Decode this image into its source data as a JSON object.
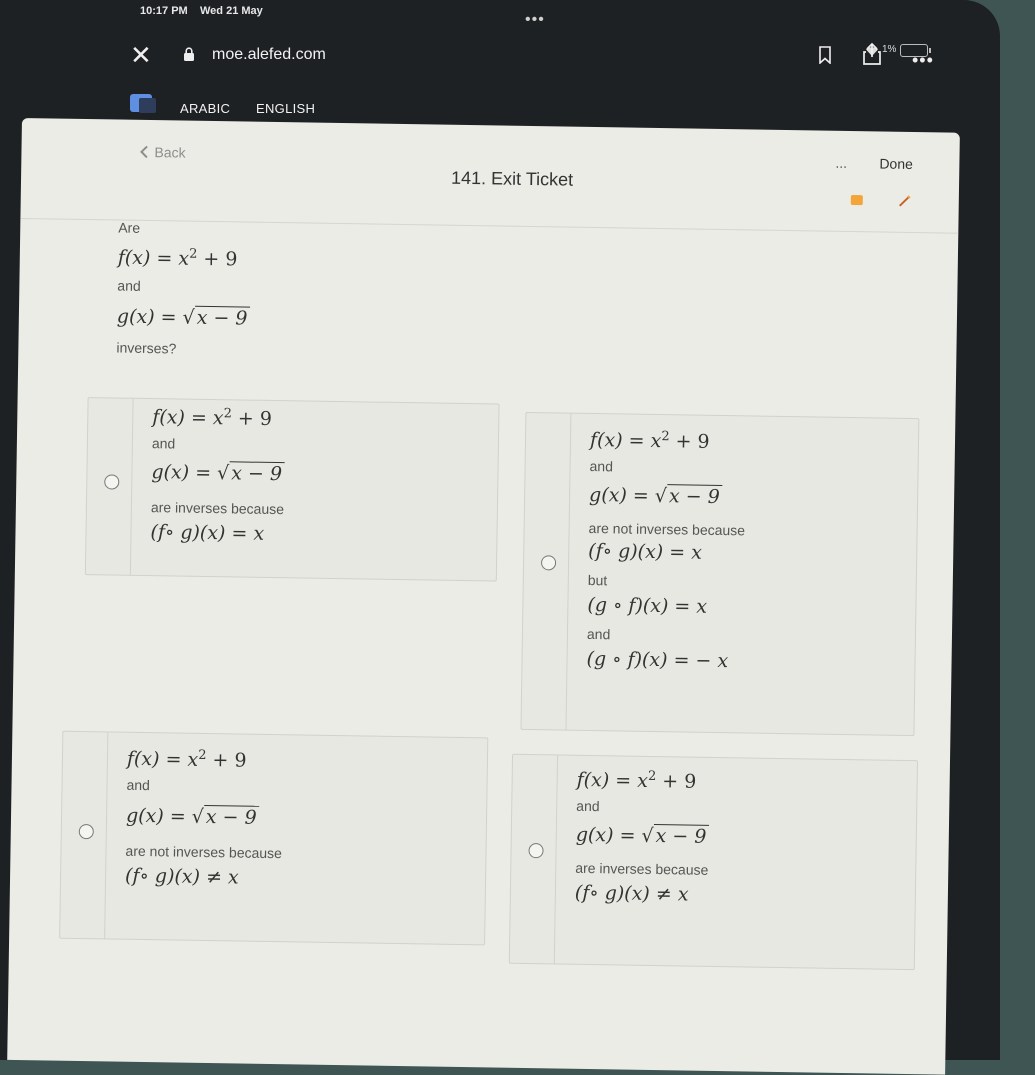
{
  "status_bar": {
    "time": "10:17 PM",
    "date": "Wed 21 May",
    "battery": "1%"
  },
  "browser": {
    "url": "moe.alefed.com"
  },
  "language_tabs": [
    "ARABIC",
    "ENGLISH"
  ],
  "sheet": {
    "back_label": "Back",
    "title": "141. Exit Ticket",
    "done_label": "Done",
    "more_label": "..."
  },
  "question": {
    "are": "Are",
    "f_lhs": "f(x) = x",
    "f_exp": "2",
    "f_rhs": " + 9",
    "and": "and",
    "g_lhs": "g(x) = ",
    "g_rad": "x − 9",
    "tail": "inverses?"
  },
  "options": [
    {
      "f_lhs": "f(x) = x",
      "f_exp": "2",
      "f_rhs": " + 9",
      "and": "and",
      "g_lhs": "g(x) = ",
      "g_rad": "x − 9",
      "reason": "are inverses because",
      "comp": "(f∘ g)(x) = x"
    },
    {
      "f_lhs": "f(x) = x",
      "f_exp": "2",
      "f_rhs": " + 9",
      "and": "and",
      "g_lhs": "g(x) = ",
      "g_rad": "x − 9",
      "reason": "are not inverses because",
      "comp1": "(f∘ g)(x) = x",
      "but": "but",
      "comp2": "(g ∘ f)(x) = x",
      "and2": "and",
      "comp3": "(g ∘ f)(x) = − x"
    },
    {
      "f_lhs": "f(x) = x",
      "f_exp": "2",
      "f_rhs": " + 9",
      "and": "and",
      "g_lhs": "g(x) = ",
      "g_rad": "x − 9",
      "reason": "are not inverses because",
      "comp": "(f∘ g)(x) ≠ x"
    },
    {
      "f_lhs": "f(x) = x",
      "f_exp": "2",
      "f_rhs": " + 9",
      "and": "and",
      "g_lhs": "g(x) = ",
      "g_rad": "x − 9",
      "reason": "are inverses because",
      "comp": "(f∘ g)(x) ≠ x"
    }
  ]
}
